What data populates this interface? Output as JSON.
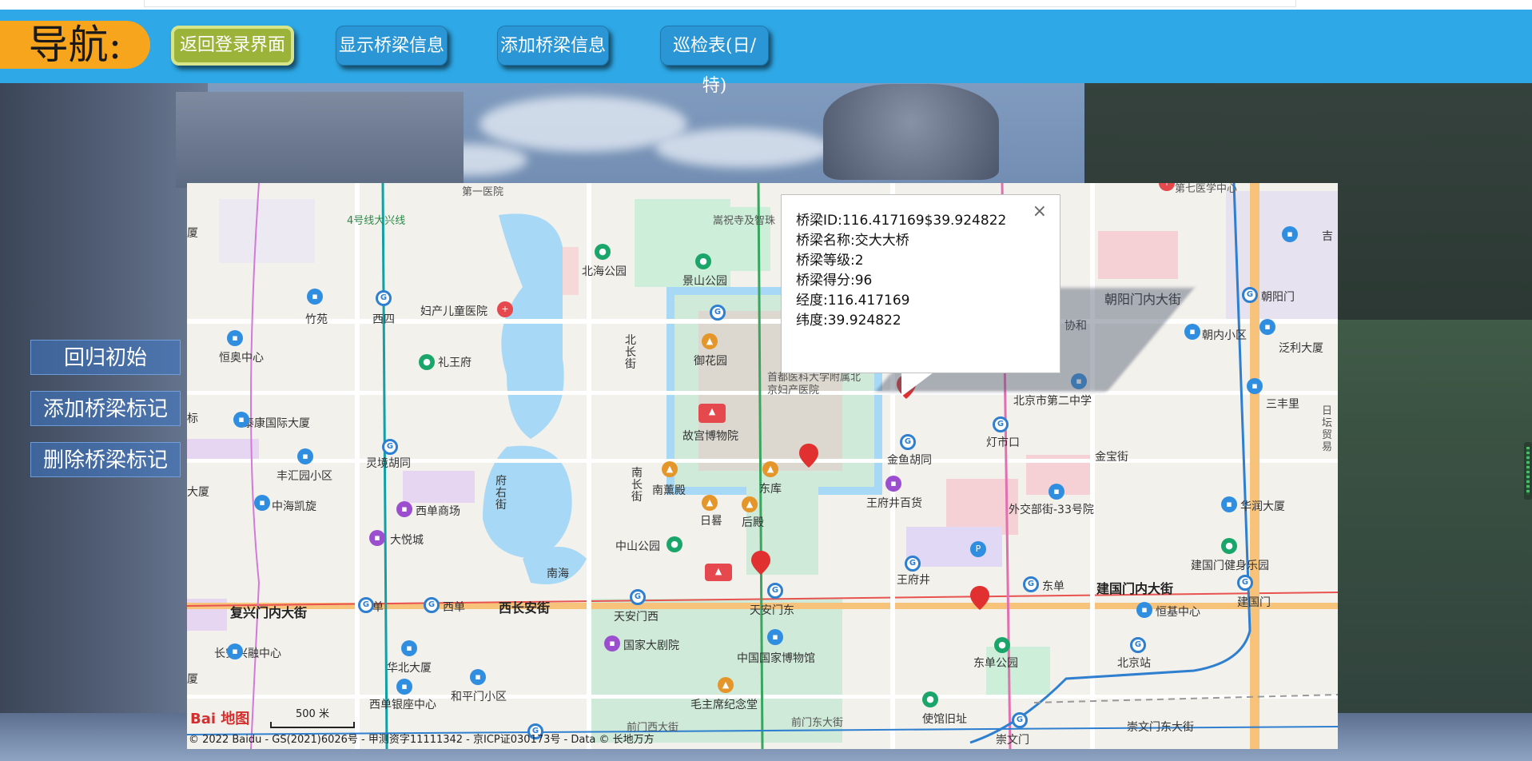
{
  "navbar": {
    "title": "导航:",
    "buttons": [
      {
        "label": "返回登录界面",
        "active": true
      },
      {
        "label": "显示桥梁信息",
        "active": false
      },
      {
        "label": "添加桥梁信息",
        "active": false
      },
      {
        "label": "巡检表(日/特)",
        "active": false
      }
    ]
  },
  "side_controls": [
    {
      "label": "回归初始"
    },
    {
      "label": "添加桥梁标记"
    },
    {
      "label": "删除桥梁标记"
    }
  ],
  "info_window": {
    "close_icon": "×",
    "lines": [
      "桥梁ID:116.417169$39.924822",
      "桥梁名称:交大大桥",
      "桥梁等级:2",
      "桥梁得分:96",
      "经度:116.417169",
      "纬度:39.924822"
    ]
  },
  "map": {
    "logo": "Bai 地图",
    "scale_label": "500 米",
    "copyright": "© 2022 Baidu - GS(2021)6026号 - 甲测资字11111342 - 京ICP证030173号 - Data © 长地万方",
    "labels": {
      "l_disanyiyuan": "第一医院",
      "l_songzhusi": "嵩祝寺及智珠",
      "l_line4": "4号线大兴线",
      "l_beihai": "北海公园",
      "l_jingshan": "景山公园",
      "l_zhuyuan": "竹苑",
      "l_xisi": "西四",
      "l_fuchan": "妇产儿童医院",
      "l_hengao": "恒奥中心",
      "l_liwangfu": "礼王府",
      "l_beichangjie": "北长街",
      "l_yuhuayuan": "御花园",
      "l_shoudu": "首都医科大学附属北京妇产医院",
      "l_gugong": "故宫博物院",
      "l_taibao": "泰康国际大厦",
      "l_lingjing": "灵境胡同",
      "l_fenghui": "丰汇园小区",
      "l_fuyoujie": "府右街",
      "l_nanxundian": "南薰殿",
      "l_dongku": "东库",
      "l_nanchangjie": "南长街",
      "l_zhonghai": "中海凯旋",
      "l_xidan_mall": "西单商场",
      "l_riguo": "日晷",
      "l_houdian": "后殿",
      "l_dayuecheng": "大悦城",
      "l_zhongshan": "中山公园",
      "l_nanhai": "南海",
      "l_fuxingmen": "复兴门内大街",
      "l_xidan1": "西单",
      "l_xidan2": "西单",
      "l_xichangan": "西长安街",
      "l_tamxi": "天安门西",
      "l_tamdong": "天安门东",
      "l_guojiadajuyuan": "国家大剧院",
      "l_guobo": "中国国家博物馆",
      "l_changan_xingrong": "长安兴融中心",
      "l_huabei": "华北大厦",
      "l_hepingmen": "和平门小区",
      "l_xidanyinzuo": "西单银座中心",
      "l_maozhuxi": "毛主席纪念堂",
      "l_qianmen_xi": "前门西大街",
      "l_qianmen_dong": "前门东大街",
      "l_jinyu": "金鱼胡同",
      "l_wangfujing_bh": "王府井百货",
      "l_wangfujing": "王府井",
      "l_dengshikou": "灯市口",
      "l_jinbaojie": "金宝街",
      "l_waijiaobu": "外交部街-33号院",
      "l_bj2zhong": "北京市第二中学",
      "l_chaoyangmennei": "朝阳门内大街",
      "l_chaoyangmen": "朝阳门",
      "l_chaonei_xq": "朝内小区",
      "l_fanli": "泛利大厦",
      "l_sanfengli": "三丰里",
      "l_huarun": "华润大厦",
      "l_jianguomen_fit": "建国门健身乐园",
      "l_jianguomennei": "建国门内大街",
      "l_jianguomen": "建国门",
      "l_dongdan": "东单",
      "l_hengji": "恒基中心",
      "l_dongdan_park": "东单公园",
      "l_beijingzhan": "北京站",
      "l_chongwenmen": "崇文门",
      "l_chongwenmen_dong": "崇文门东大街",
      "l_shiguan": "使馆旧址",
      "l_di7yiyuan": "第七医学中心",
      "l_jiyuan": "吉",
      "l_ritan": "日坛贸易",
      "l_xia": "厦",
      "l_dasha": "大厦",
      "l_chang": "厦",
      "l_biao": "标",
      "l_xiehe": "协和"
    }
  },
  "colors": {
    "navbar_bg": "#2ea8e6",
    "title_bg": "#f7a51c",
    "active_btn": "#9cb33a",
    "button_bg": "#2a96d6",
    "marker": "#e0302f"
  },
  "icons": [
    "close-icon",
    "map-marker-icon",
    "metro-icon",
    "park-icon",
    "hospital-icon",
    "building-icon"
  ]
}
